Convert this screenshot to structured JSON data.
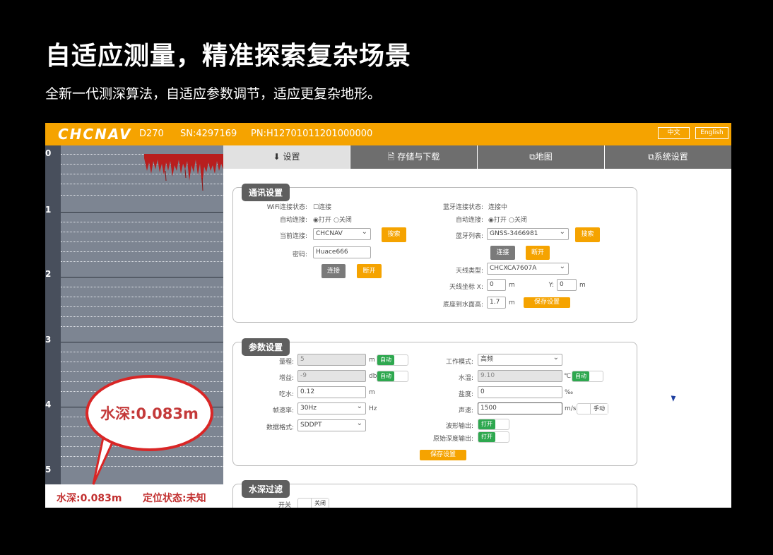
{
  "slide": {
    "title": "自适应测量，精准探索复杂场景",
    "subtitle": "全新一代测深算法，自适应参数调节，适应更复杂地形。"
  },
  "header": {
    "logo": "CHCNAV",
    "model": "D270",
    "sn": "SN:4297169",
    "pn": "PN:H12701011201000000",
    "lang_cn": "中文",
    "lang_en": "English"
  },
  "echogram": {
    "depth_labels": [
      "0",
      "1",
      "2",
      "3",
      "4",
      "5"
    ],
    "depth_status": "水深:0.083m",
    "position_status": "定位状态:未知",
    "callout": "水深:0.083m"
  },
  "tabs": [
    {
      "icon": "download-icon",
      "label": "设置"
    },
    {
      "icon": "file-icon",
      "label": "存储与下载"
    },
    {
      "icon": "map-icon",
      "label": "地图"
    },
    {
      "icon": "settings-icon",
      "label": "系统设置"
    }
  ],
  "comm": {
    "title": "通讯设置",
    "wifi_status_label": "WiFi连接状态:",
    "wifi_status_value": "☐连接",
    "auto_connect_label": "自动连接:",
    "auto_on": "◉打开",
    "auto_off": "○关闭",
    "current_conn_label": "当前连接:",
    "current_conn_value": "CHCNAV",
    "search_label": "搜索",
    "password_label": "密码:",
    "password_value": "Huace666",
    "connect_label": "连接",
    "disconnect_label": "断开",
    "bt_status_label": "蓝牙连接状态:",
    "bt_status_value": "连接中",
    "bt_auto_label": "自动连接:",
    "bt_auto_on": "◉打开",
    "bt_auto_off": "○关闭",
    "bt_list_label": "蓝牙列表:",
    "bt_list_value": "GNSS-3466981",
    "bt_search_label": "搜索",
    "bt_connect_label": "连接",
    "bt_disconnect_label": "断开",
    "antenna_type_label": "天线类型:",
    "antenna_type_value": "CHCXCA7607A",
    "antenna_x_label": "天线坐标 X:",
    "antenna_x_value": "0",
    "antenna_y_label": "Y:",
    "antenna_y_value": "0",
    "unit_m": "m",
    "base_height_label": "底座到水面高:",
    "base_height_value": "1.7",
    "save_label": "保存设置"
  },
  "params": {
    "title": "参数设置",
    "range_label": "量程:",
    "range_value": "5",
    "unit_m": "m",
    "auto_label": "自动",
    "gain_label": "增益:",
    "gain_value": "-9",
    "unit_db": "db",
    "draft_label": "吃水:",
    "draft_value": "0.12",
    "rate_label": "帧速率:",
    "rate_value": "30Hz",
    "unit_hz": "Hz",
    "format_label": "数据格式:",
    "format_value": "SDDPT",
    "mode_label": "工作模式:",
    "mode_value": "高频",
    "temp_label": "水温:",
    "temp_value": "9.10",
    "unit_c": "℃",
    "salinity_label": "盐度:",
    "salinity_value": "0",
    "unit_permil": "‰",
    "sound_label": "声速:",
    "sound_value": "1500",
    "unit_ms": "m/s",
    "manual_label": "手动",
    "wave_label": "波形输出:",
    "raw_label": "原始深度输出:",
    "open_label": "打开",
    "save_label": "保存设置"
  },
  "filter": {
    "title": "水深过滤",
    "switch_label": "开关",
    "off_label": "关闭"
  },
  "colors": {
    "brand": "#f5a300",
    "callout_red": "#d92626",
    "toggle_green": "#2ea84f"
  }
}
